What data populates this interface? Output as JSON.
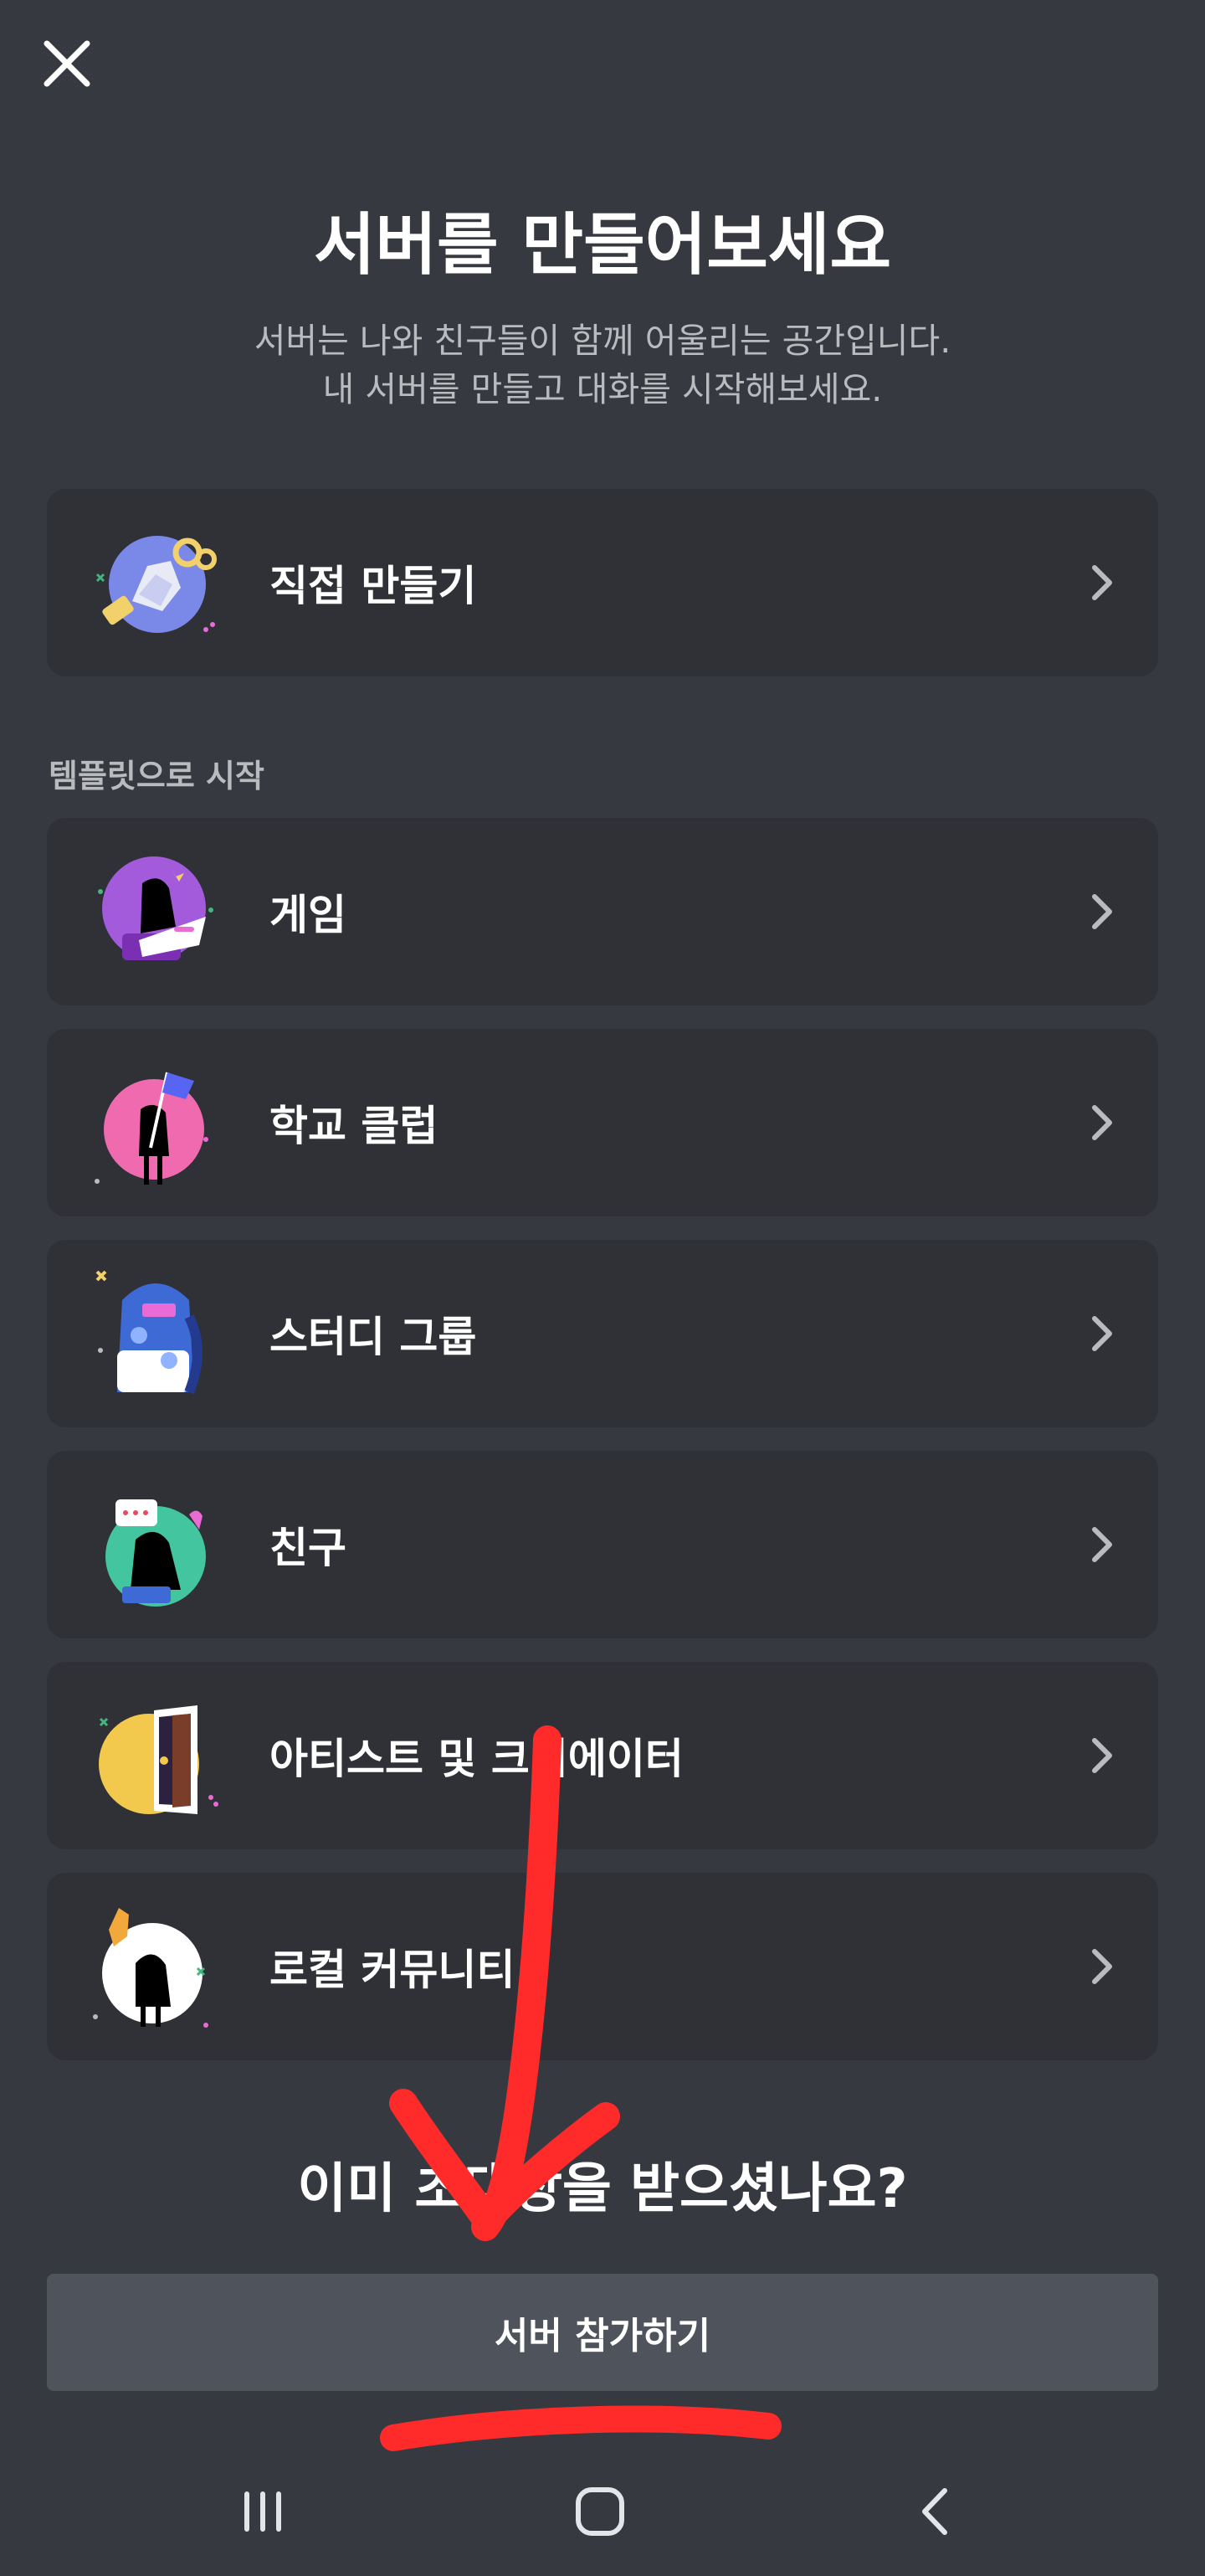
{
  "header": {
    "close_icon": "close-icon",
    "title": "서버를 만들어보세요",
    "subtitle_line1": "서버는 나와 친구들이 함께 어울리는 공간입니다.",
    "subtitle_line2": "내 서버를 만들고 대화를 시작해보세요."
  },
  "create_own": {
    "label": "직접 만들기",
    "icon": "create-server-illustration"
  },
  "templates": {
    "section_label": "템플릿으로 시작",
    "items": [
      {
        "label": "게임",
        "icon": "gaming-illustration"
      },
      {
        "label": "학교 클럽",
        "icon": "school-club-illustration"
      },
      {
        "label": "스터디 그룹",
        "icon": "study-group-illustration"
      },
      {
        "label": "친구",
        "icon": "friends-illustration"
      },
      {
        "label": "아티스트 및 크리에이터",
        "icon": "artists-creators-illustration"
      },
      {
        "label": "로컬 커뮤니티",
        "icon": "local-community-illustration"
      }
    ]
  },
  "invite": {
    "heading": "이미 초대장을 받으셨나요?",
    "join_button": "서버 참가하기"
  },
  "navbar": {
    "recents_icon": "recents-icon",
    "home_icon": "home-icon",
    "back_icon": "back-icon"
  },
  "colors": {
    "background": "#36393f",
    "card": "#2f3136",
    "button": "#4f545c",
    "annotation_red": "#ff2b2b"
  }
}
